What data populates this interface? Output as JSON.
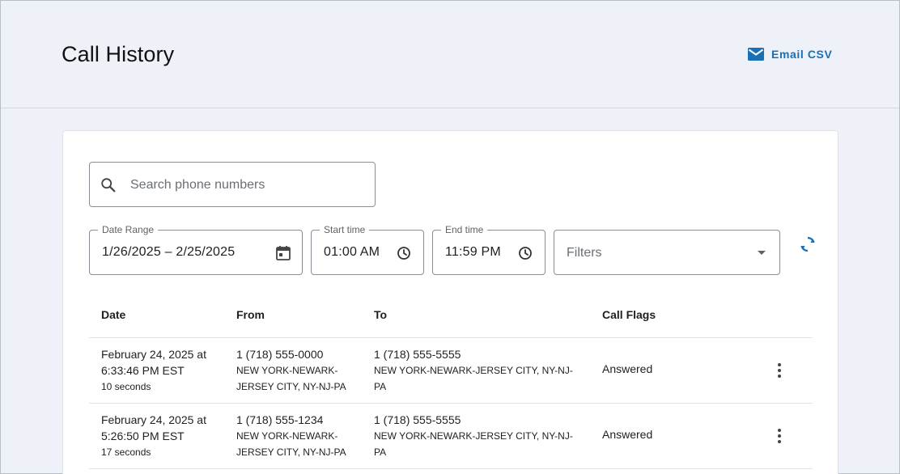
{
  "header": {
    "title": "Call History",
    "email_csv_label": "Email CSV"
  },
  "search": {
    "placeholder": "Search phone numbers",
    "value": ""
  },
  "filters": {
    "date_range": {
      "label": "Date Range",
      "value": "1/26/2025  – 2/25/2025"
    },
    "start_time": {
      "label": "Start time",
      "value": "01:00 AM"
    },
    "end_time": {
      "label": "End time",
      "value": "11:59 PM"
    },
    "filters_dropdown": {
      "placeholder": "Filters"
    }
  },
  "table": {
    "columns": [
      "Date",
      "From",
      "To",
      "Call Flags"
    ],
    "rows": [
      {
        "date_line1": "February 24, 2025 at",
        "date_line2": "6:33:46 PM EST",
        "duration": "10 seconds",
        "from_number": "1 (718) 555-0000",
        "from_loc1": "NEW YORK-NEWARK-",
        "from_loc2": "JERSEY CITY, NY-NJ-PA",
        "to_number": "1 (718) 555-5555",
        "to_loc1": "NEW YORK-NEWARK-JERSEY CITY, NY-NJ-",
        "to_loc2": "PA",
        "flags": "Answered"
      },
      {
        "date_line1": "February 24, 2025 at",
        "date_line2": "5:26:50 PM EST",
        "duration": "17 seconds",
        "from_number": "1 (718) 555-1234",
        "from_loc1": "NEW YORK-NEWARK-",
        "from_loc2": "JERSEY CITY, NY-NJ-PA",
        "to_number": "1 (718) 555-5555",
        "to_loc1": "NEW YORK-NEWARK-JERSEY CITY, NY-NJ-",
        "to_loc2": "PA",
        "flags": "Answered"
      }
    ]
  },
  "icons": {
    "email": "mail-icon",
    "search": "search-icon",
    "calendar": "calendar-icon",
    "clock": "clock-icon",
    "dropdown": "dropdown-arrow-icon",
    "refresh": "refresh-icon",
    "more": "more-vertical-icon"
  },
  "colors": {
    "accent": "#1a6fb5",
    "page_background": "#eef2f8",
    "card_background": "#ffffff"
  }
}
